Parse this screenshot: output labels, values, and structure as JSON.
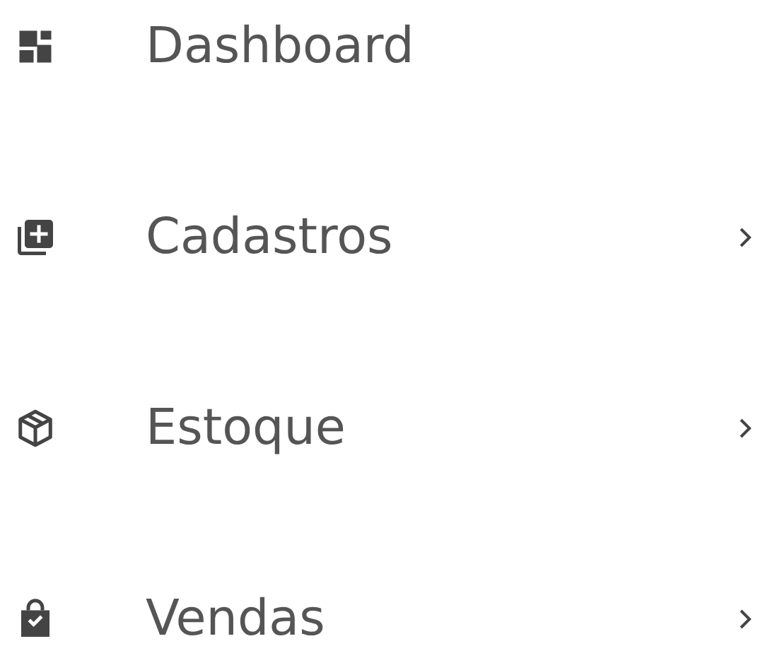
{
  "menu": [
    {
      "label": "Dashboard",
      "kind": "dashboard",
      "has_submenu": false
    },
    {
      "label": "Cadastros",
      "kind": "add",
      "has_submenu": true
    },
    {
      "label": "Estoque",
      "kind": "stock",
      "has_submenu": true
    },
    {
      "label": "Vendas",
      "kind": "sales",
      "has_submenu": true
    }
  ]
}
